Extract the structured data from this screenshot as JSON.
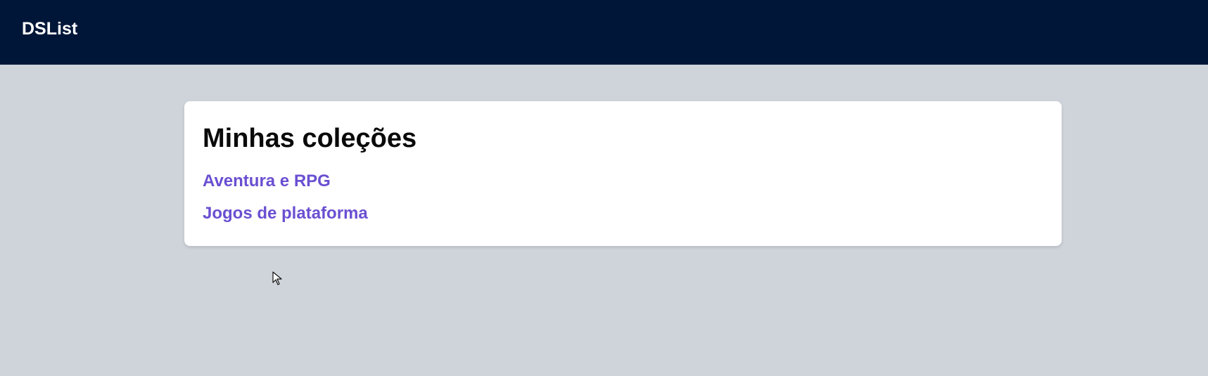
{
  "header": {
    "brand": "DSList",
    "background_color": "#001639"
  },
  "page": {
    "background_color": "#cfd3da"
  },
  "collections": {
    "title": "Minhas coleções",
    "link_color": "#6a4fd1",
    "items": [
      {
        "label": "Aventura e RPG"
      },
      {
        "label": "Jogos de plataforma"
      }
    ]
  },
  "cursor": {
    "icon": "mouse-pointer-icon"
  }
}
